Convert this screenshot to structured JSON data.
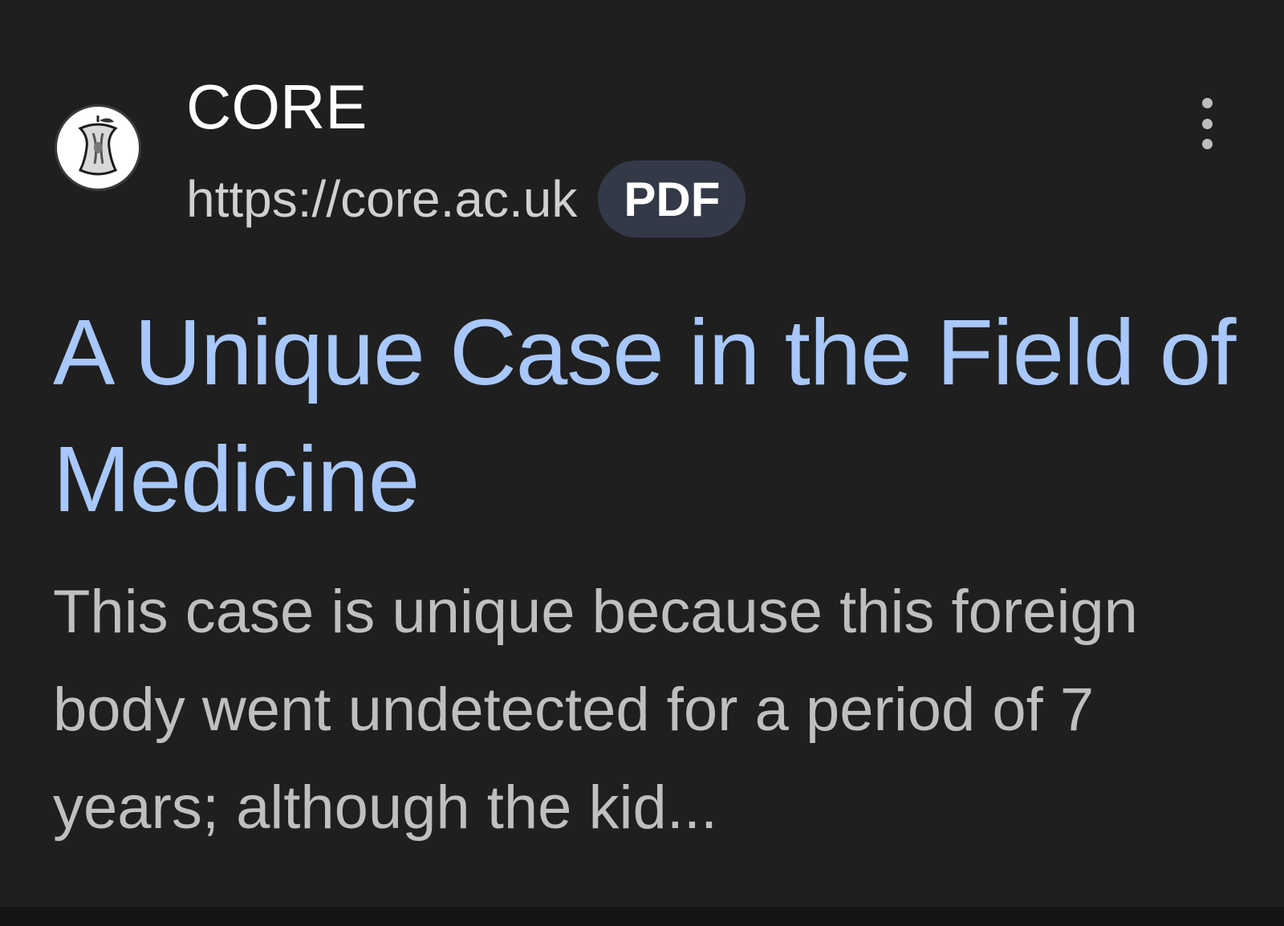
{
  "result": {
    "site_name": "CORE",
    "url": "https://core.ac.uk",
    "badge": "PDF",
    "title": "A Unique Case in the Field of Medicine",
    "snippet": "This case is unique because this foreign body went undetected for a period of 7 years; although the kid...",
    "favicon_icon": "core-logo-icon",
    "menu_icon": "more-vert-icon"
  },
  "colors": {
    "background": "#1f1f1f",
    "title_link": "#a8c7fa",
    "snippet_text": "#bfbfbf",
    "url_text": "#d0d0d0",
    "badge_background": "#333947"
  }
}
